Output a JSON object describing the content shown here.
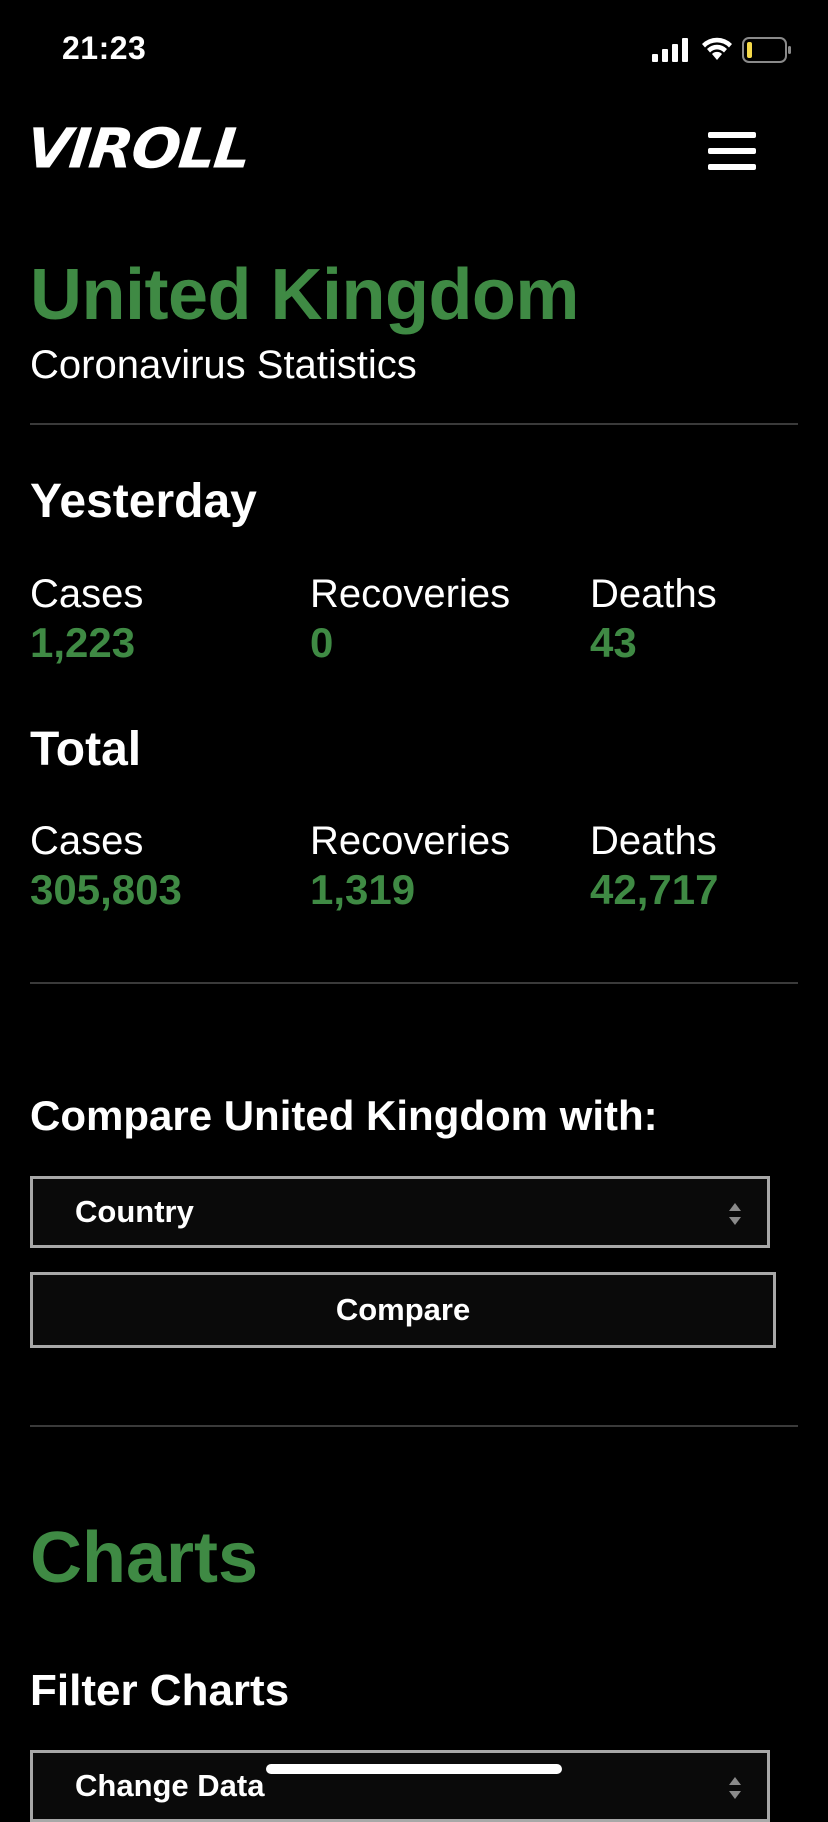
{
  "status_bar": {
    "time": "21:23",
    "icons": [
      "signal-icon",
      "wifi-icon",
      "battery-icon"
    ],
    "battery_color": "#f5d94a"
  },
  "header": {
    "logo": "VIROLL",
    "menu_icon": "hamburger-menu-icon"
  },
  "page": {
    "title": "United Kingdom",
    "subtitle": "Coronavirus Statistics"
  },
  "yesterday": {
    "heading": "Yesterday",
    "stats": [
      {
        "label": "Cases",
        "value": "1,223"
      },
      {
        "label": "Recoveries",
        "value": "0"
      },
      {
        "label": "Deaths",
        "value": "43"
      }
    ]
  },
  "total": {
    "heading": "Total",
    "stats": [
      {
        "label": "Cases",
        "value": "305,803"
      },
      {
        "label": "Recoveries",
        "value": "1,319"
      },
      {
        "label": "Deaths",
        "value": "42,717"
      }
    ]
  },
  "compare": {
    "heading": "Compare United Kingdom with:",
    "select_value": "Country",
    "button_label": "Compare"
  },
  "charts": {
    "title": "Charts",
    "filter_heading": "Filter Charts",
    "select_value": "Change Data"
  },
  "colors": {
    "accent": "#3f8a44",
    "background": "#000000",
    "border": "#a8a8a8"
  }
}
